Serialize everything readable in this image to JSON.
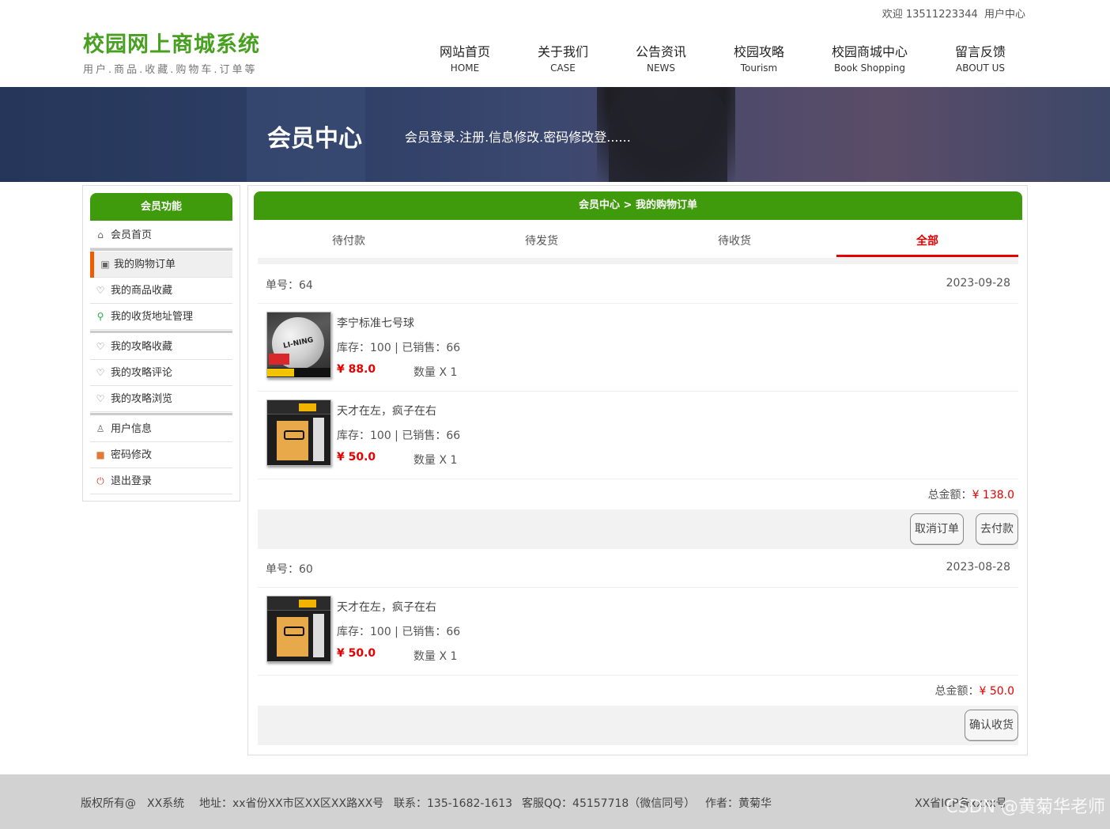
{
  "header": {
    "welcome": "欢迎 13511223344",
    "user_center": "用户中心",
    "site_title": "校园网上商城系统",
    "site_subtitle": "用户.商品.收藏.购物车.订单等",
    "nav": [
      {
        "cn": "网站首页",
        "en": "HOME"
      },
      {
        "cn": "关于我们",
        "en": "CASE"
      },
      {
        "cn": "公告资讯",
        "en": "NEWS"
      },
      {
        "cn": "校园攻略",
        "en": "Tourism"
      },
      {
        "cn": "校园商城中心",
        "en": "Book Shopping"
      },
      {
        "cn": "留言反馈",
        "en": "ABOUT US"
      }
    ]
  },
  "banner": {
    "title": "会员中心",
    "subtitle": "会员登录.注册.信息修改.密码修改登......"
  },
  "sidebar": {
    "title": "会员功能",
    "items": [
      {
        "label": "会员首页",
        "icon": "home-icon"
      },
      {
        "label": "我的购物订单",
        "icon": "wallet-icon",
        "active": true
      },
      {
        "label": "我的商品收藏",
        "icon": "heart-icon"
      },
      {
        "label": "我的收货地址管理",
        "icon": "location-icon"
      },
      {
        "label": "我的攻略收藏",
        "icon": "heart-icon"
      },
      {
        "label": "我的攻略评论",
        "icon": "heart-icon"
      },
      {
        "label": "我的攻略浏览",
        "icon": "heart-icon"
      },
      {
        "label": "用户信息",
        "icon": "user-icon"
      },
      {
        "label": "密码修改",
        "icon": "lock-icon"
      },
      {
        "label": "退出登录",
        "icon": "power-icon"
      }
    ]
  },
  "main": {
    "breadcrumb": "会员中心 > 我的购物订单",
    "tabs": [
      "待付款",
      "待发货",
      "待收货",
      "全部"
    ],
    "active_tab": "全部",
    "orders": [
      {
        "no_label": "单号：64",
        "date": "2023-09-28",
        "items": [
          {
            "name": "李宁标准七号球",
            "stock": "库存：100 | 已销售：66",
            "price": "¥ 88.0",
            "qty": "数量 X 1"
          },
          {
            "name": "天才在左，疯子在右",
            "stock": "库存：100 | 已销售：66",
            "price": "¥ 50.0",
            "qty": "数量 X 1"
          }
        ],
        "total_label": "总金额：",
        "total": "¥ 138.0",
        "actions": [
          "取消订单",
          "去付款"
        ]
      },
      {
        "no_label": "单号：60",
        "date": "2023-08-28",
        "items": [
          {
            "name": "天才在左，疯子在右",
            "stock": "库存：100 | 已销售：66",
            "price": "¥ 50.0",
            "qty": "数量 X 1"
          }
        ],
        "total_label": "总金额：",
        "total": "¥ 50.0",
        "actions": [
          "确认收货"
        ]
      }
    ]
  },
  "footer": {
    "copyright": "版权所有@",
    "system": "XX系统",
    "address": "地址：xx省份XX市区XX区XX路XX号",
    "phone": "联系：135-1682-1613",
    "qq": "客服QQ：45157718（微信同号）",
    "author": "作者：黄菊华",
    "icp": "XX省ICP备xxxx号",
    "watermark": "CSDN @黄菊华老师"
  },
  "colors": {
    "accent_green": "#3f9b0b",
    "price_red": "#e60000",
    "active_marker": "#f25a00"
  }
}
